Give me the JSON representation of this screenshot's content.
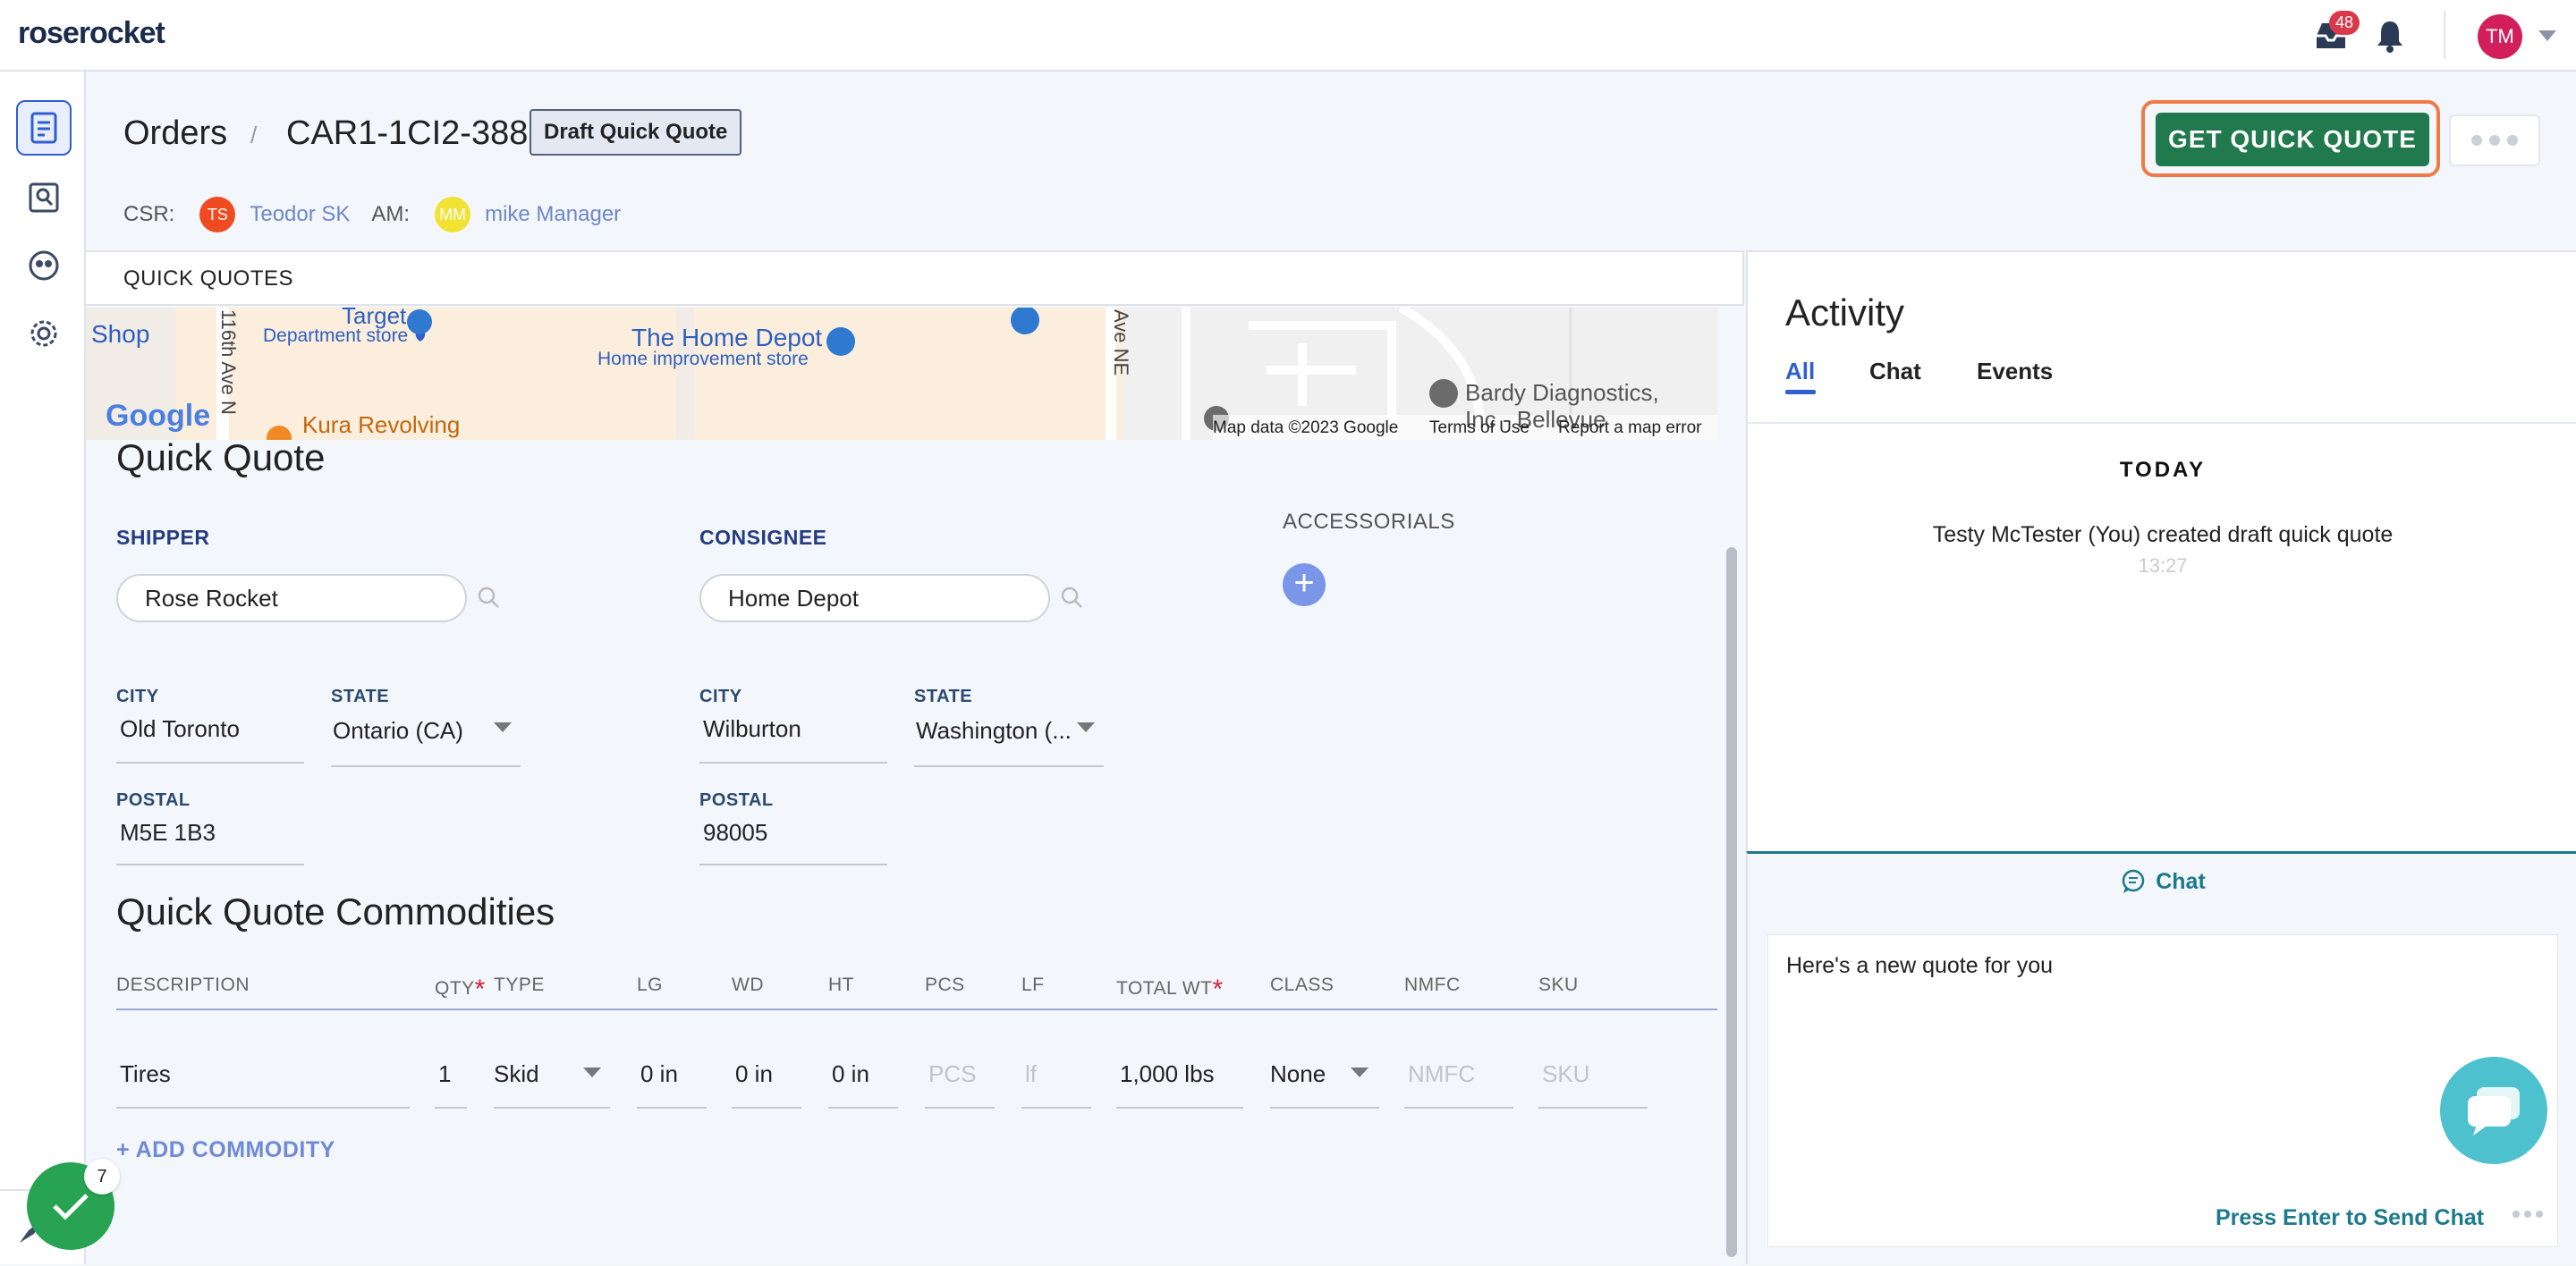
{
  "app": {
    "logo_part1": "rose",
    "logo_part2": "rocket",
    "notification_count": "48",
    "user_initials": "TM"
  },
  "header": {
    "breadcrumb_root": "Orders",
    "separator": "/",
    "order_id": "CAR1-1CI2-388",
    "status": "Draft Quick Quote",
    "csr_label": "CSR:",
    "csr_initials": "TS",
    "csr_name": "Teodor SK",
    "am_label": "AM:",
    "am_initials": "MM",
    "am_name": "mike Manager",
    "primary_button": "GET QUICK QUOTE"
  },
  "panel": {
    "tab_label": "QUICK QUOTES"
  },
  "map": {
    "labels": [
      "Shop",
      "Target",
      "Department store",
      "The Home Depot",
      "Home improvement store",
      "116th Ave N",
      "Ave NE",
      "Bardy Diagnostics,",
      "Inc - Bellevue",
      "Kura Revolving",
      "Google"
    ],
    "footer": [
      "Map data ©2023 Google",
      "Terms of Use",
      "Report a map error"
    ]
  },
  "quote": {
    "title": "Quick Quote",
    "shipper_label": "SHIPPER",
    "shipper_value": "Rose Rocket",
    "consignee_label": "CONSIGNEE",
    "consignee_value": "Home Depot",
    "accessorials_label": "ACCESSORIALS",
    "plus": "+",
    "city_label": "CITY",
    "state_label": "STATE",
    "postal_label": "POSTAL",
    "shipper_city": "Old Toronto",
    "shipper_state": "Ontario (CA)",
    "shipper_postal": "M5E 1B3",
    "consignee_city": "Wilburton",
    "consignee_state": "Washington (...",
    "consignee_postal": "98005"
  },
  "commodities": {
    "title": "Quick Quote Commodities",
    "columns": [
      "DESCRIPTION",
      "QTY",
      "TYPE",
      "LG",
      "WD",
      "HT",
      "PCS",
      "LF",
      "TOTAL WT",
      "CLASS",
      "NMFC",
      "SKU"
    ],
    "required_mark": "*",
    "row": {
      "description": "Tires",
      "qty": "1",
      "type": "Skid",
      "lg": "0 in",
      "wd": "0 in",
      "ht": "0 in",
      "pcs": "PCS",
      "lf": "lf",
      "total_wt": "1,000 lbs",
      "class": "None",
      "nmfc": "NMFC",
      "sku": "SKU"
    },
    "add_label": "+ ADD COMMODITY"
  },
  "activity": {
    "title": "Activity",
    "tabs": [
      "All",
      "Chat",
      "Events"
    ],
    "day": "TODAY",
    "message": "Testy McTester (You) created draft quick quote",
    "time": "13:27"
  },
  "chat": {
    "title": "Chat",
    "draft": "Here's a new quote for you",
    "send_hint": "Press Enter to Send Chat"
  },
  "tasks": {
    "count": "7"
  },
  "colors": {
    "brand_green": "#217a4d",
    "accent_blue": "#2f5fd0",
    "chat_teal": "#1d7a8c",
    "highlight_orange": "#ef7a45"
  }
}
